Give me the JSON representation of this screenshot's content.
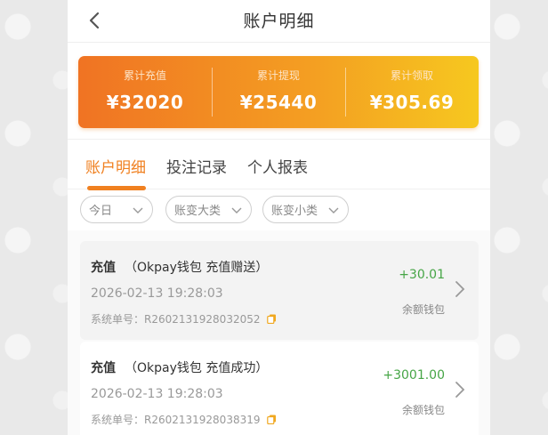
{
  "header": {
    "title": "账户明细"
  },
  "summary": [
    {
      "label": "累计充值",
      "value": "¥32020"
    },
    {
      "label": "累计提现",
      "value": "¥25440"
    },
    {
      "label": "累计领取",
      "value": "¥305.69"
    }
  ],
  "tabs": [
    {
      "label": "账户明细",
      "active": true
    },
    {
      "label": "投注记录",
      "active": false
    },
    {
      "label": "个人报表",
      "active": false
    }
  ],
  "filters": [
    {
      "value": "今日"
    },
    {
      "value": "账变大类"
    },
    {
      "value": "账变小类"
    }
  ],
  "records": [
    {
      "type": "充值",
      "detail": "（Okpay钱包 充值赠送）",
      "time": "2026-02-13 19:28:03",
      "order": "系统单号：R2602131928032052",
      "amount": "+30.01",
      "wallet": "余额钱包"
    },
    {
      "type": "充值",
      "detail": "（Okpay钱包 充值成功）",
      "time": "2026-02-13 19:28:03",
      "order": "系统单号：R2602131928038319",
      "amount": "+3001.00",
      "wallet": "余额钱包"
    }
  ],
  "colors": {
    "accent": "#f08020",
    "positive": "#46a546",
    "gradient_start": "#f07323",
    "gradient_end": "#f6c81f"
  }
}
